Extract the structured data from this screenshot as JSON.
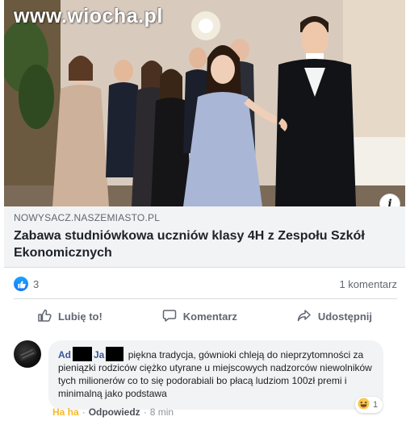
{
  "watermark": "www.wiocha.pl",
  "link_preview": {
    "domain": "NOWYSACZ.NASZEMIASTO.PL",
    "title": "Zabawa studniówkowa uczniów klasy 4H z Zespołu Szkół Ekonomicznych",
    "info_icon": "info-icon"
  },
  "reactions": {
    "like_count": "3",
    "comment_count": "1 komentarz"
  },
  "actions": {
    "like": "Lubię to!",
    "comment": "Komentarz",
    "share": "Udostępnij"
  },
  "comment": {
    "author_start": "Ad",
    "author_mid": "Ja",
    "text": "piękna tradycja, gównioki chleją do nieprzytomności za pieniązki rodziców ciężko utyrane u miejscowych nadzorców niewolników tych milionerów co to się podorabiali bo płacą ludziom 100zł premi i minimalną jako podstawa",
    "reaction_count": "1",
    "reaction_icon": "haha-emoji",
    "meta": {
      "haha": "Ha ha",
      "reply": "Odpowiedz",
      "time": "8 min",
      "separator": "·"
    }
  },
  "colors": {
    "facebook_blue": "#1877f2",
    "link_box_bg": "#f2f3f5",
    "secondary_text": "#606770",
    "haha_yellow": "#f7b928"
  }
}
